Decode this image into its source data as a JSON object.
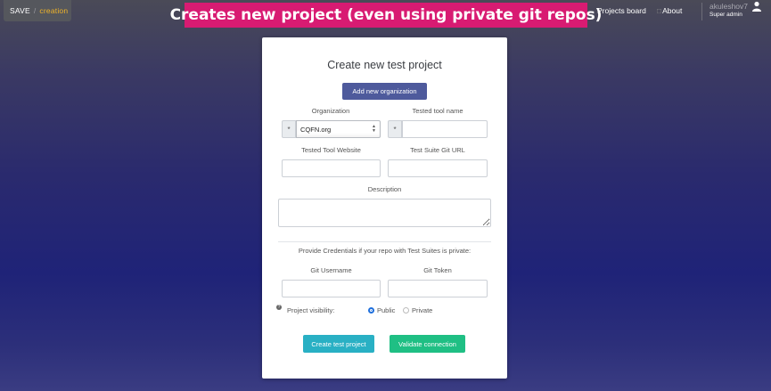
{
  "topbar": {
    "brand": "SAVE",
    "separator": "/",
    "crumb": "creation",
    "banner": "Creates new project (even using private git repos)",
    "nav_projects": "Projects board",
    "nav_about": "About",
    "user_name": "akuleshov7",
    "user_role": "Super admin"
  },
  "form": {
    "title": "Create new test project",
    "add_org_button": "Add new organization",
    "organization_label": "Organization",
    "required_marker": "*",
    "organization_value": "CQFN.org",
    "tested_tool_name_label": "Tested tool name",
    "tested_tool_website_label": "Tested Tool Website",
    "test_suite_git_url_label": "Test Suite Git URL",
    "description_label": "Description",
    "credentials_hint": "Provide Credentials if your repo with Test Suites is private:",
    "git_username_label": "Git Username",
    "git_token_label": "Git Token",
    "visibility_label": "Project visibility:",
    "visibility_public": "Public",
    "visibility_private": "Private",
    "visibility_selected": "Public",
    "create_button": "Create test project",
    "validate_button": "Validate connection"
  },
  "colors": {
    "banner": "#d81b72",
    "add_org_button": "#4e5a9c",
    "create_button": "#29b0c4",
    "validate_button": "#1fbf84",
    "crumb": "#f0b429"
  }
}
